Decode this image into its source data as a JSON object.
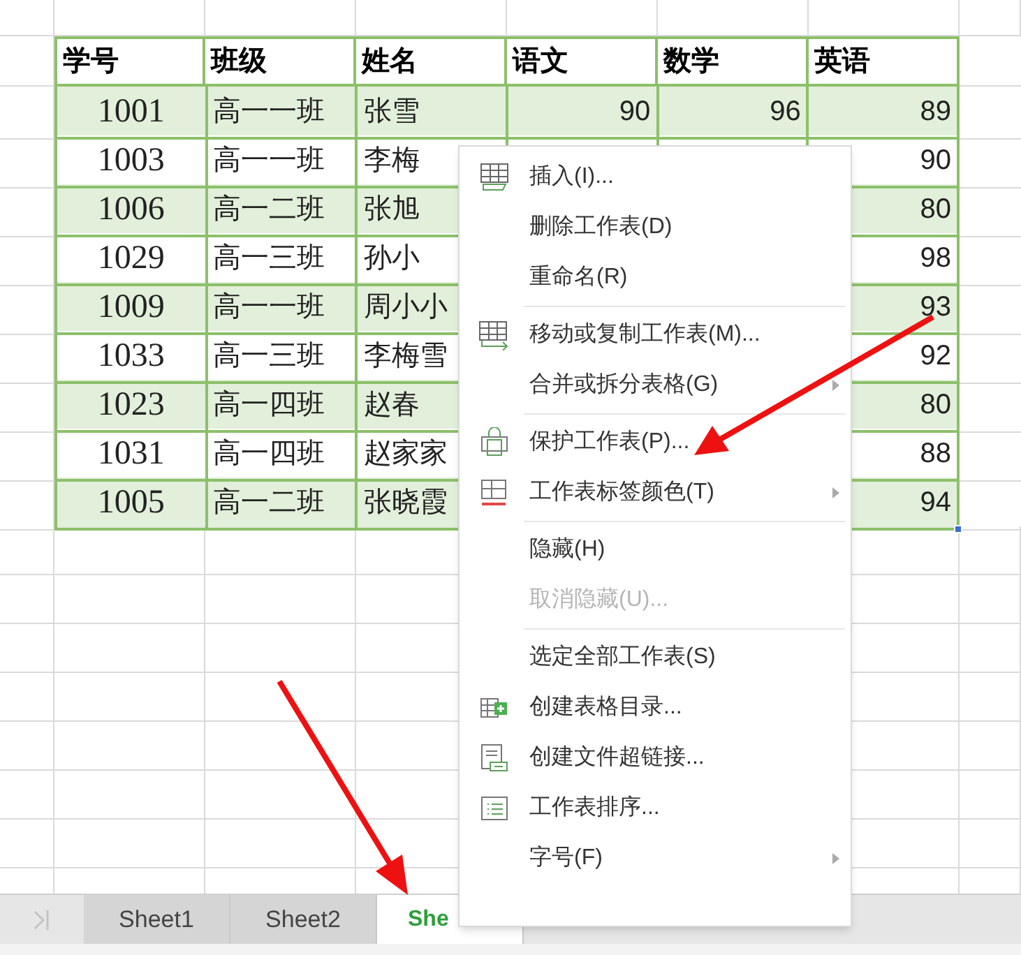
{
  "table": {
    "columns": [
      "学号",
      "班级",
      "姓名",
      "语文",
      "数学",
      "英语"
    ],
    "rows": [
      {
        "shaded": true,
        "id": "1001",
        "class": "高一一班",
        "name": "张雪",
        "chinese": "90",
        "math": "96",
        "english": "89"
      },
      {
        "shaded": false,
        "id": "1003",
        "class": "高一一班",
        "name": "李梅",
        "english": "90"
      },
      {
        "shaded": true,
        "id": "1006",
        "class": "高一二班",
        "name": "张旭",
        "english": "80"
      },
      {
        "shaded": false,
        "id": "1029",
        "class": "高一三班",
        "name": "孙小",
        "english": "98"
      },
      {
        "shaded": true,
        "id": "1009",
        "class": "高一一班",
        "name": "周小小",
        "english": "93"
      },
      {
        "shaded": false,
        "id": "1033",
        "class": "高一三班",
        "name": "李梅雪",
        "english": "92"
      },
      {
        "shaded": true,
        "id": "1023",
        "class": "高一四班",
        "name": "赵春",
        "english": "80"
      },
      {
        "shaded": false,
        "id": "1031",
        "class": "高一四班",
        "name": "赵家家",
        "english": "88"
      },
      {
        "shaded": true,
        "id": "1005",
        "class": "高一二班",
        "name": "张晓霞",
        "english": "94"
      }
    ]
  },
  "context_menu": {
    "items": [
      {
        "kind": "item",
        "label": "插入(I)...",
        "submenu": false,
        "disabled": false
      },
      {
        "kind": "item",
        "label": "删除工作表(D)",
        "submenu": false,
        "disabled": false
      },
      {
        "kind": "item",
        "label": "重命名(R)",
        "submenu": false,
        "disabled": false
      },
      {
        "kind": "separator"
      },
      {
        "kind": "item",
        "label": "移动或复制工作表(M)...",
        "submenu": false,
        "disabled": false
      },
      {
        "kind": "item",
        "label": "合并或拆分表格(G)",
        "submenu": true,
        "disabled": false
      },
      {
        "kind": "separator"
      },
      {
        "kind": "item",
        "label": "保护工作表(P)...",
        "submenu": false,
        "disabled": false
      },
      {
        "kind": "item",
        "label": "工作表标签颜色(T)",
        "submenu": true,
        "disabled": false
      },
      {
        "kind": "separator"
      },
      {
        "kind": "item",
        "label": "隐藏(H)",
        "submenu": false,
        "disabled": false
      },
      {
        "kind": "item",
        "label": "取消隐藏(U)...",
        "submenu": false,
        "disabled": true
      },
      {
        "kind": "separator"
      },
      {
        "kind": "item",
        "label": "选定全部工作表(S)",
        "submenu": false,
        "disabled": false
      },
      {
        "kind": "item",
        "label": "创建表格目录...",
        "submenu": false,
        "disabled": false
      },
      {
        "kind": "item",
        "label": "创建文件超链接...",
        "submenu": false,
        "disabled": false
      },
      {
        "kind": "item",
        "label": "工作表排序...",
        "submenu": false,
        "disabled": false
      },
      {
        "kind": "item",
        "label": "字号(F)",
        "submenu": true,
        "disabled": false
      }
    ]
  },
  "sheet_tabs": [
    {
      "label": "Sheet1",
      "selected": false
    },
    {
      "label": "Sheet2",
      "selected": false
    },
    {
      "label": "She",
      "selected": true
    }
  ]
}
